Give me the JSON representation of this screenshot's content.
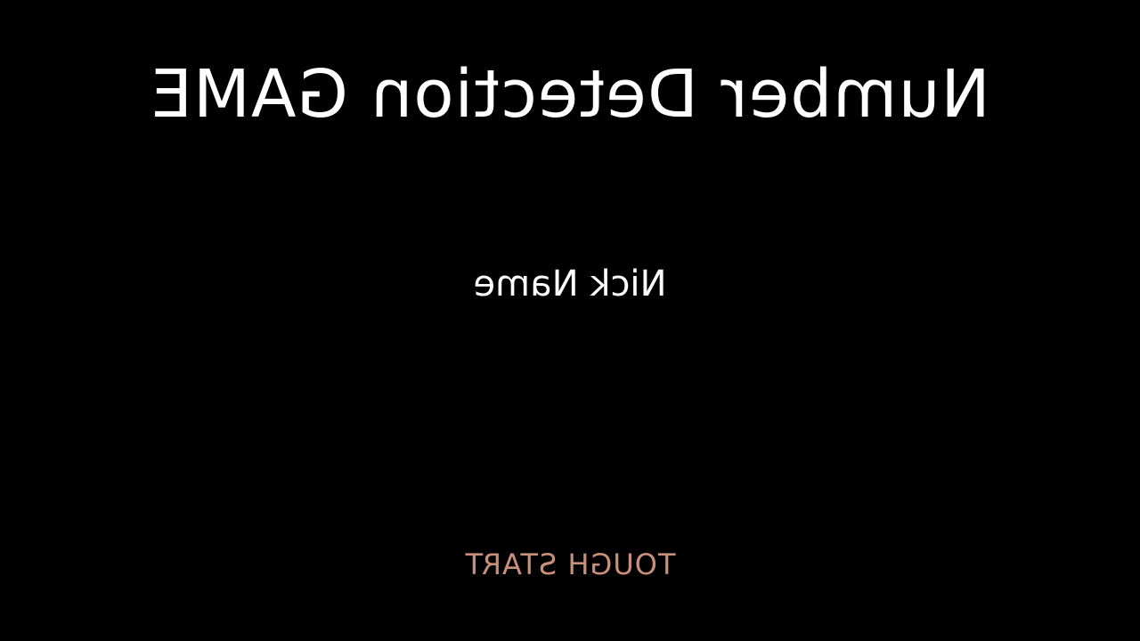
{
  "screen": {
    "title": "Number Detection GAME",
    "nickname_label": "Nick Name",
    "start_label": "TOUGH START"
  },
  "colors": {
    "background": "#000000",
    "title_text": "#ffffff",
    "nickname_text": "#ffffff",
    "start_text": "#c8907a"
  },
  "rendering": {
    "text_orientation": "mirrored-horizontal"
  }
}
